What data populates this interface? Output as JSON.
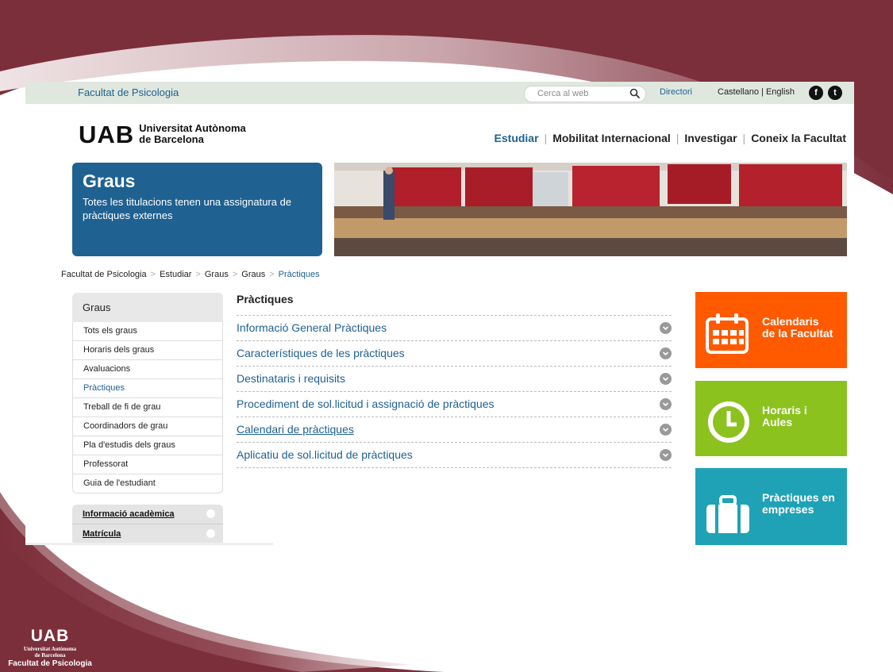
{
  "colors": {
    "brand_blue": "#1f6191",
    "maroon": "#7b2f3b",
    "tile_orange": "#ff5a00",
    "tile_green": "#8cc21e",
    "tile_teal": "#1fa2b6",
    "topbar_bg": "#dfe7df"
  },
  "topbar": {
    "faculty": "Facultat de Psicologia",
    "search_placeholder": "Cerca al web",
    "directory": "Directori",
    "languages": "Castellano | English",
    "social": [
      "facebook-icon",
      "twitter-icon"
    ]
  },
  "logo": {
    "mark": "UAB",
    "line1": "Universitat Autònoma",
    "line2": "de Barcelona"
  },
  "nav": {
    "items": [
      "Estudiar",
      "Mobilitat Internacional",
      "Investigar",
      "Coneix la Facultat"
    ],
    "active": "Estudiar"
  },
  "hero": {
    "title": "Graus",
    "subtitle": "Totes les titulacions tenen una assignatura de pràctiques externes"
  },
  "breadcrumb": [
    "Facultat de Psicologia",
    "Estudiar",
    "Graus",
    "Graus",
    "Pràctiques"
  ],
  "sidebar": {
    "heading": "Graus",
    "items": [
      "Tots els graus",
      "Horaris dels graus",
      "Avaluacions",
      "Pràctiques",
      "Treball de fi de grau",
      "Coordinadors de grau",
      "Pla d'estudis dels graus",
      "Professorat",
      "Guia de l'estudiant"
    ],
    "extra": [
      "Informació acadèmica",
      "Matrícula"
    ]
  },
  "content": {
    "title": "Pràctiques",
    "sections": [
      "Informació General Pràctiques",
      "Característiques de les pràctiques",
      "Destinataris i requisits",
      "Procediment de sol.licitud i assignació de pràctiques",
      "Calendari de pràctiques",
      "Aplicatiu de sol.licitud de pràctiques"
    ]
  },
  "tiles": [
    {
      "label1": "Calendaris",
      "label2": "de la Facultat",
      "icon": "calendar-icon"
    },
    {
      "label1": "Horaris i",
      "label2": "Aules",
      "icon": "clock-icon"
    },
    {
      "label1": "Pràctiques en",
      "label2": "empreses",
      "icon": "briefcase-icon"
    }
  ],
  "footer": {
    "mark": "UAB",
    "line1": "Universitat Autònoma",
    "line2": "de Barcelona",
    "faculty": "Facultat de Psicologia"
  }
}
